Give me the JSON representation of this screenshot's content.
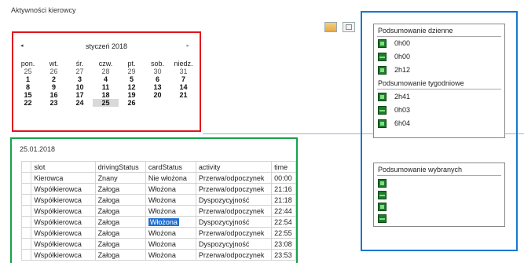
{
  "app": {
    "title": "Aktywności kierowcy"
  },
  "calendar": {
    "month_label": "styczeń 2018",
    "prev_glyph": "◂",
    "next_glyph": "▸",
    "weekdays": [
      "pon.",
      "wt.",
      "śr.",
      "czw.",
      "pt.",
      "sob.",
      "niedz."
    ],
    "weeks": [
      [
        "25",
        "26",
        "27",
        "28",
        "29",
        "30",
        "31"
      ],
      [
        "1",
        "2",
        "3",
        "4",
        "5",
        "6",
        "7"
      ],
      [
        "8",
        "9",
        "10",
        "11",
        "12",
        "13",
        "14"
      ],
      [
        "15",
        "16",
        "17",
        "18",
        "19",
        "20",
        "21"
      ],
      [
        "22",
        "23",
        "24",
        "25",
        "26",
        "",
        ""
      ]
    ],
    "selected_day": "25"
  },
  "summary": {
    "daily_title": "Podsumowanie dzienne",
    "daily": [
      "0h00",
      "0h00",
      "2h12"
    ],
    "weekly_title": "Podsumowanie tygodniowe",
    "weekly": [
      "2h41",
      "0h03",
      "6h04"
    ],
    "selected_title": "Podsumowanie wybranych",
    "icons": [
      "driving-icon",
      "work-icon",
      "availability-icon",
      "rest-icon"
    ]
  },
  "table": {
    "date": "25.01.2018",
    "columns": [
      "slot",
      "drivingStatus",
      "cardStatus",
      "activity",
      "time"
    ],
    "rows": [
      [
        "Kierowca",
        "Znany",
        "Nie włożona",
        "Przerwa/odpoczynek",
        "00:00"
      ],
      [
        "Współkierowca",
        "Załoga",
        "Włożona",
        "Przerwa/odpoczynek",
        "21:16"
      ],
      [
        "Współkierowca",
        "Załoga",
        "Włożona",
        "Dyspozycyjność",
        "21:18"
      ],
      [
        "Współkierowca",
        "Załoga",
        "Włożona",
        "Przerwa/odpoczynek",
        "22:44"
      ],
      [
        "Współkierowca",
        "Załoga",
        "Włożona",
        "Dyspozycyjność",
        "22:54"
      ],
      [
        "Współkierowca",
        "Załoga",
        "Włożona",
        "Przerwa/odpoczynek",
        "22:55"
      ],
      [
        "Współkierowca",
        "Załoga",
        "Włożona",
        "Dyspozycyjność",
        "23:08"
      ],
      [
        "Współkierowca",
        "Załoga",
        "Włożona",
        "Przerwa/odpoczynek",
        "23:53"
      ]
    ],
    "selected_row": 4,
    "selected_col": 2
  },
  "colors": {
    "calendar_border": "#e0141c",
    "summary_border": "#1777d0",
    "table_border": "#16a24a",
    "selection": "#1f6fd1"
  }
}
